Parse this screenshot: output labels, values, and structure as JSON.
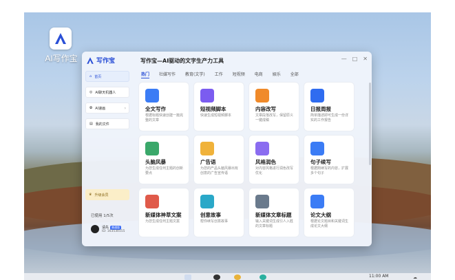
{
  "desktop": {
    "app_icon_label": "AI写作宝"
  },
  "window": {
    "logo_text": "写作宝",
    "title": "写作宝—AI驱动的文字生产力工具",
    "buttons": {
      "minimize": "—",
      "maximize": "□",
      "close": "✕"
    }
  },
  "sidebar": {
    "items": [
      {
        "label": "首页"
      },
      {
        "label": "AI聊天机器人"
      },
      {
        "label": "AI速画"
      },
      {
        "label": "我的文件"
      }
    ],
    "upgrade_label": "升级会员",
    "usage": "已使用 1/5次",
    "user": {
      "name": "请先",
      "badge": "普通版",
      "id": "ID: 163530155"
    }
  },
  "tabs": [
    "热门",
    "社媒写作",
    "教育(文学)",
    "工作",
    "短视频",
    "电商",
    "娱乐",
    "全部"
  ],
  "cards": [
    {
      "title": "全文写作",
      "desc": "根据标题快速创建一篇完整的文章",
      "color": "#3b7cf5"
    },
    {
      "title": "短视频脚本",
      "desc": "快速生成短视频脚本",
      "color": "#7b5cf0"
    },
    {
      "title": "内容改写",
      "desc": "文章段落改写，保留原义一键成稿",
      "color": "#f08a2a"
    },
    {
      "title": "日报周报",
      "desc": "简单描述即可生成一份详实的工作报告",
      "color": "#2f6cf0"
    },
    {
      "title": "头脑风暴",
      "desc": "为您生成任何主题的创新要点",
      "color": "#3aa86a"
    },
    {
      "title": "广告语",
      "desc": "为您的产品头脑风暴出有创意的广告宣传语",
      "color": "#f0b23a"
    },
    {
      "title": "风格润色",
      "desc": "对内容风格进行润色改写优化",
      "color": "#8a6cf0"
    },
    {
      "title": "句子续写",
      "desc": "根据刚续写的内容，扩展多个句子",
      "color": "#3b7cf5"
    },
    {
      "title": "新媒体神草文案",
      "desc": "为您生成任何主题文案",
      "color": "#e05a4a"
    },
    {
      "title": "创意故事",
      "desc": "帮你续写创意故事",
      "color": "#2aa8c8"
    },
    {
      "title": "新媒体文章标题",
      "desc": "输入关键词生成引人入胜的文章标题",
      "color": "#6a7a8c"
    },
    {
      "title": "论文大纲",
      "desc": "根据论文题目和关键词生成论文大纲",
      "color": "#3b7cf5"
    }
  ],
  "taskbar": {
    "clock": "11:00 AM",
    "tray": "☁"
  }
}
